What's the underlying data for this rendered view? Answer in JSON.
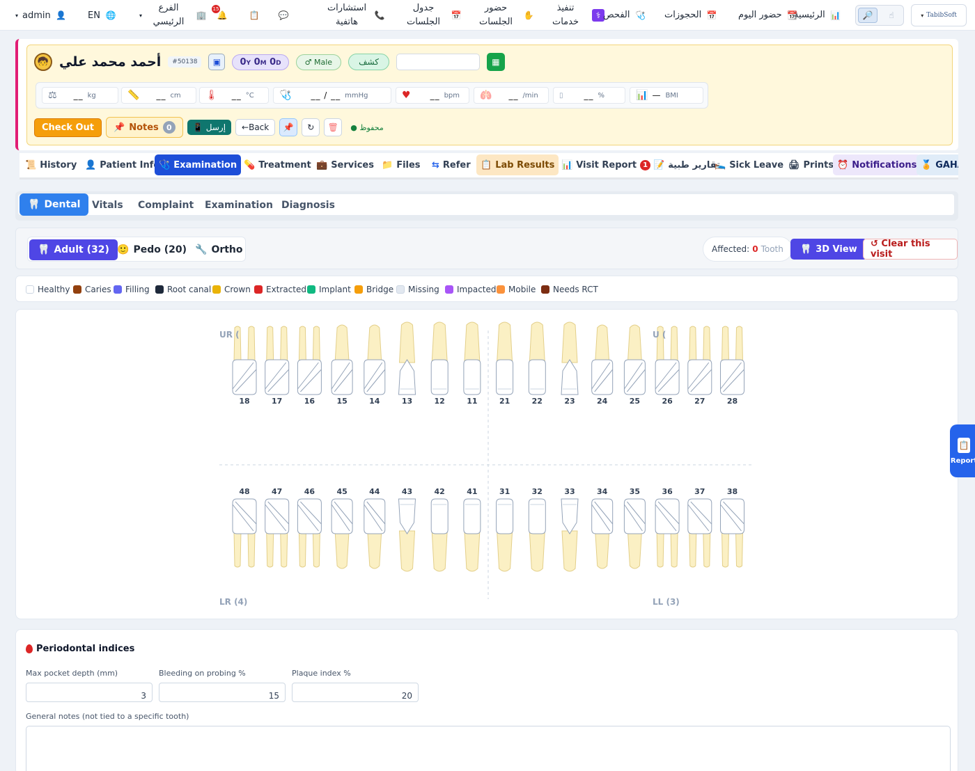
{
  "topnav": {
    "user": "admin",
    "lang": "EN",
    "branch": "الفرع الرئيسي",
    "notif_count": "15",
    "items": [
      {
        "label": "استشارات هاتفية"
      },
      {
        "label": "جدول الجلسات"
      },
      {
        "label": "حضور الجلسات"
      },
      {
        "label": "تنفيذ خدمات"
      },
      {
        "label": "الفحص"
      },
      {
        "label": "الحجوزات"
      },
      {
        "label": "حضور اليوم"
      },
      {
        "label": "الرئيسية"
      }
    ],
    "logo": "TabibSoft"
  },
  "patient": {
    "name": "أحمد محمد علي",
    "id": "#50138",
    "age": {
      "y": "0",
      "y_unit": "Y",
      "m": "0",
      "m_unit": "M",
      "d": "0",
      "d_unit": "D"
    },
    "sex": "♂ Male",
    "visit_type": "كشف",
    "vitals": [
      {
        "icon": "scale-icon",
        "value": "__",
        "unit": "kg"
      },
      {
        "icon": "ruler-icon",
        "value": "__",
        "unit": "cm"
      },
      {
        "icon": "thermometer-icon",
        "value": "__",
        "unit": "°C"
      },
      {
        "icon": "stethoscope-icon",
        "value": "__ / __",
        "unit": "mmHg"
      },
      {
        "icon": "heart-icon",
        "value": "__",
        "unit": "bpm"
      },
      {
        "icon": "lungs-icon",
        "value": "__",
        "unit": "/min"
      },
      {
        "icon": "oxygen-icon",
        "value": "__",
        "unit": "%"
      },
      {
        "icon": "bmi-icon",
        "value": "—",
        "unit": "BMI"
      }
    ],
    "actions": {
      "checkout": "Check Out",
      "notes": "Notes",
      "notes_count": "0",
      "send": "إرسل",
      "back": "←Back",
      "saved": "● محفوظ"
    }
  },
  "main_tabs": [
    {
      "label": "History"
    },
    {
      "label": "Patient Info"
    },
    {
      "label": "Examination"
    },
    {
      "label": "Treatment"
    },
    {
      "label": "Services"
    },
    {
      "label": "Files"
    },
    {
      "label": "Refer"
    },
    {
      "label": "Lab Results"
    },
    {
      "label": "Visit Report",
      "badge": "1"
    },
    {
      "label": "تقارير طبية"
    },
    {
      "label": "Sick Leave"
    },
    {
      "label": "Prints"
    },
    {
      "label": "Notifications"
    },
    {
      "label": "GAHA"
    }
  ],
  "sub_tabs": [
    {
      "label": "Dental"
    },
    {
      "label": "Vitals"
    },
    {
      "label": "Complaint"
    },
    {
      "label": "Examination"
    },
    {
      "label": "Diagnosis"
    }
  ],
  "dentition": {
    "adult": "Adult (32)",
    "pedo": "Pedo (20)",
    "ortho": "Ortho",
    "affected_label": "Affected:",
    "affected_count": "0",
    "affected_unit": "Tooth",
    "view3d": "3D View",
    "clear": "↺ Clear this visit"
  },
  "legend": [
    {
      "label": "Healthy",
      "color": "#ffffff"
    },
    {
      "label": "Caries",
      "color": "#92400e"
    },
    {
      "label": "Filling",
      "color": "#6366f1"
    },
    {
      "label": "Root canal",
      "color": "#1e293b"
    },
    {
      "label": "Crown",
      "color": "#eab308"
    },
    {
      "label": "Extracted",
      "color": "#dc2626"
    },
    {
      "label": "Implant",
      "color": "#10b981"
    },
    {
      "label": "Bridge",
      "color": "#f59e0b"
    },
    {
      "label": "Missing",
      "color": "#e2e8f0"
    },
    {
      "label": "Impacted",
      "color": "#a855f7"
    },
    {
      "label": "Mobile",
      "color": "#fb923c"
    },
    {
      "label": "Needs RCT",
      "color": "#7c2d12"
    }
  ],
  "chart": {
    "upper_teeth": [
      "18",
      "17",
      "16",
      "15",
      "14",
      "13",
      "12",
      "11",
      "21",
      "22",
      "23",
      "24",
      "25",
      "26",
      "27",
      "28"
    ],
    "lower_teeth": [
      "48",
      "47",
      "46",
      "45",
      "44",
      "43",
      "42",
      "41",
      "31",
      "32",
      "33",
      "34",
      "35",
      "36",
      "37",
      "38"
    ],
    "quadrants": {
      "ur": "UR (",
      "ul": "U (",
      "lr": "LR (4)",
      "ll": "LL (3)"
    }
  },
  "report_tab": "Report",
  "perio": {
    "title": "Periodontal indices",
    "fields": [
      {
        "label": "Max pocket depth (mm)",
        "value": "3"
      },
      {
        "label": "Bleeding on probing %",
        "value": "15"
      },
      {
        "label": "Plaque index %",
        "value": "20"
      }
    ],
    "notes_label": "General notes (not tied to a specific tooth)"
  }
}
